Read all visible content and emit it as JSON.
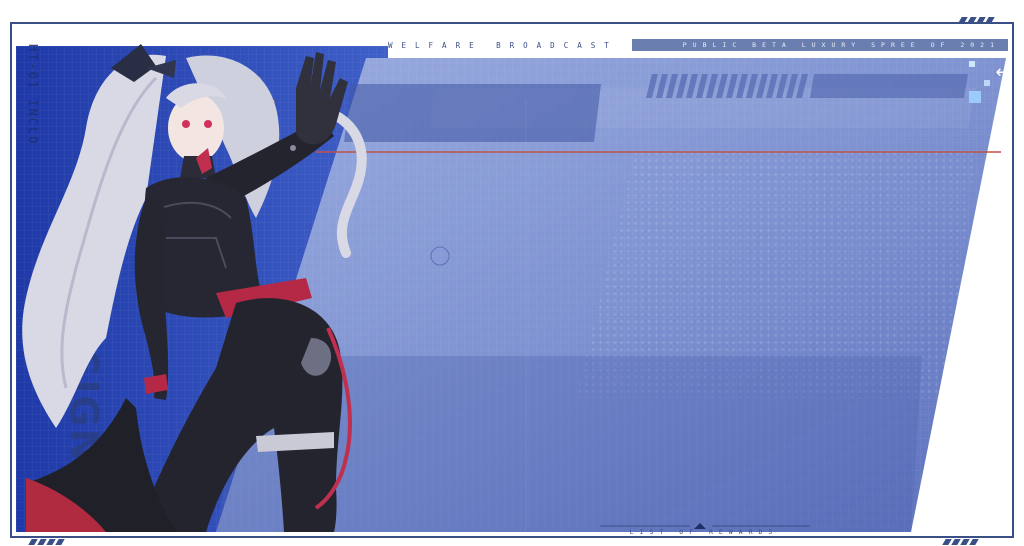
{
  "header": {
    "left_title": "WELFARE BROADCAST",
    "right_title": "PUBLIC BETA LUXURY SPREE OF 2021"
  },
  "side": {
    "vertical_code": "HT-01 INCLO",
    "vertical_word": "SIGN",
    "label_a": "L",
    "label_b": "AU"
  },
  "footer": {
    "tab_label": "LIST OF REWARDS"
  },
  "controls": {
    "back_icon": "arrow-left-icon",
    "back_glyph": "←"
  },
  "colors": {
    "frame": "#3a4f86",
    "panel": "#8a9ed9",
    "panel_dark": "#5068b8",
    "accent_line": "#c0524a"
  }
}
